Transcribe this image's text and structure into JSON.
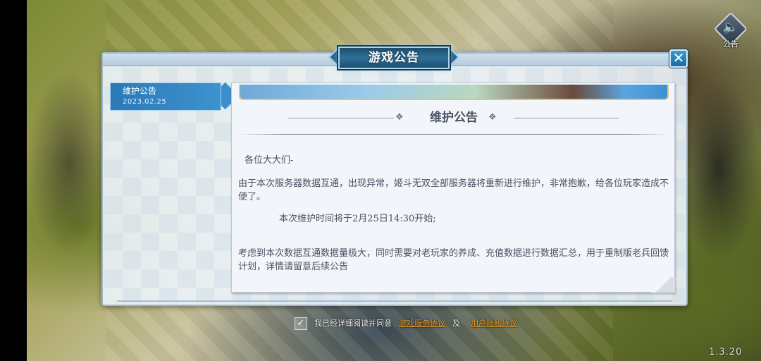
{
  "title": "游戏公告",
  "sound_button": {
    "icon": "speaker-icon",
    "label": "公告"
  },
  "close_icon": "close-icon",
  "sidebar": {
    "items": [
      {
        "title": "维护公告",
        "date": "2023.02.25",
        "selected": true
      }
    ]
  },
  "notice": {
    "heading": "维护公告",
    "greeting": "各位大大们-",
    "paragraph1": "由于本次服务器数据互通，出现异常，姬斗无双全部服务器将重新进行维护，非常抱歉，给各位玩家造成不便了。",
    "paragraph2": "本次维护时间将于2月25日14:30开始;",
    "paragraph3": "考虑到本次数据互通数据量极大，同时需要对老玩家的养成、充值数据进行数据汇总，用于重制版老兵回馈计划，详情请留意后续公告"
  },
  "agreement": {
    "checked": true,
    "text": "我已经详细阅读并同意",
    "link1": "游戏服务协议",
    "and": "及",
    "link2": "用户隐私协议"
  },
  "version": "1.3.20",
  "colors": {
    "accent": "#2b79b6",
    "title_plate": "#2f7098",
    "link": "#e59a2a",
    "panel": "#ecf3f9"
  }
}
